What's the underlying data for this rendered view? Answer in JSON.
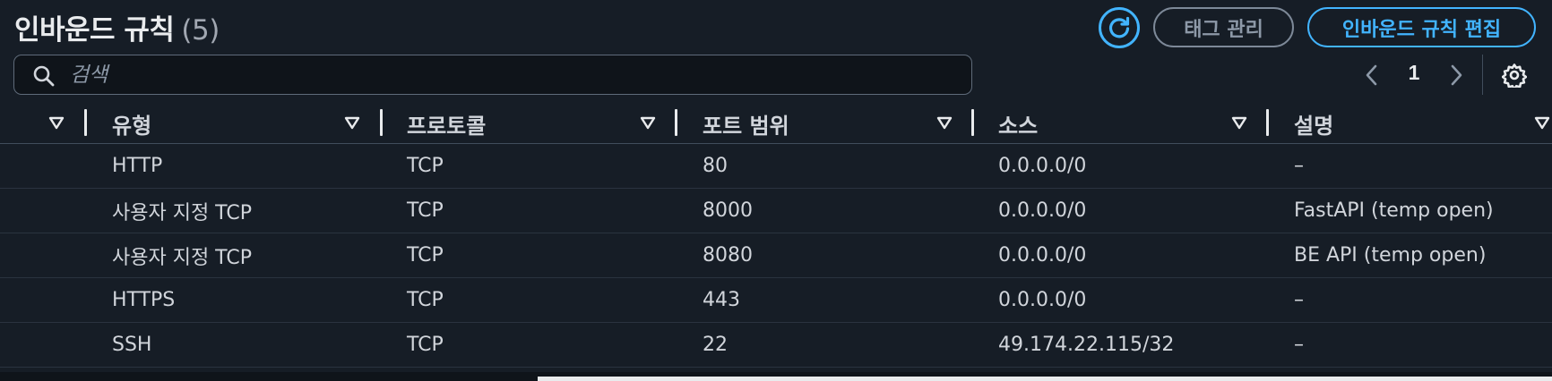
{
  "header": {
    "title": "인바운드 규칙",
    "count": "(5)",
    "tag_button_label": "태그 관리",
    "edit_button_label": "인바운드 규칙 편집"
  },
  "search": {
    "placeholder": "검색",
    "value": ""
  },
  "pagination": {
    "current_page": "1"
  },
  "table": {
    "columns": [
      "유형",
      "프로토콜",
      "포트 범위",
      "소스",
      "설명"
    ],
    "rows": [
      [
        "HTTP",
        "TCP",
        "80",
        "0.0.0.0/0",
        "–"
      ],
      [
        "사용자 지정 TCP",
        "TCP",
        "8000",
        "0.0.0.0/0",
        "FastAPI (temp open)"
      ],
      [
        "사용자 지정 TCP",
        "TCP",
        "8080",
        "0.0.0.0/0",
        "BE API (temp open)"
      ],
      [
        "HTTPS",
        "TCP",
        "443",
        "0.0.0.0/0",
        "–"
      ],
      [
        "SSH",
        "TCP",
        "22",
        "49.174.22.115/32",
        "–"
      ]
    ]
  },
  "colors": {
    "background": "#161d26",
    "accent": "#42b4ff",
    "text": "#d1d5db",
    "muted": "#8d99a8"
  }
}
